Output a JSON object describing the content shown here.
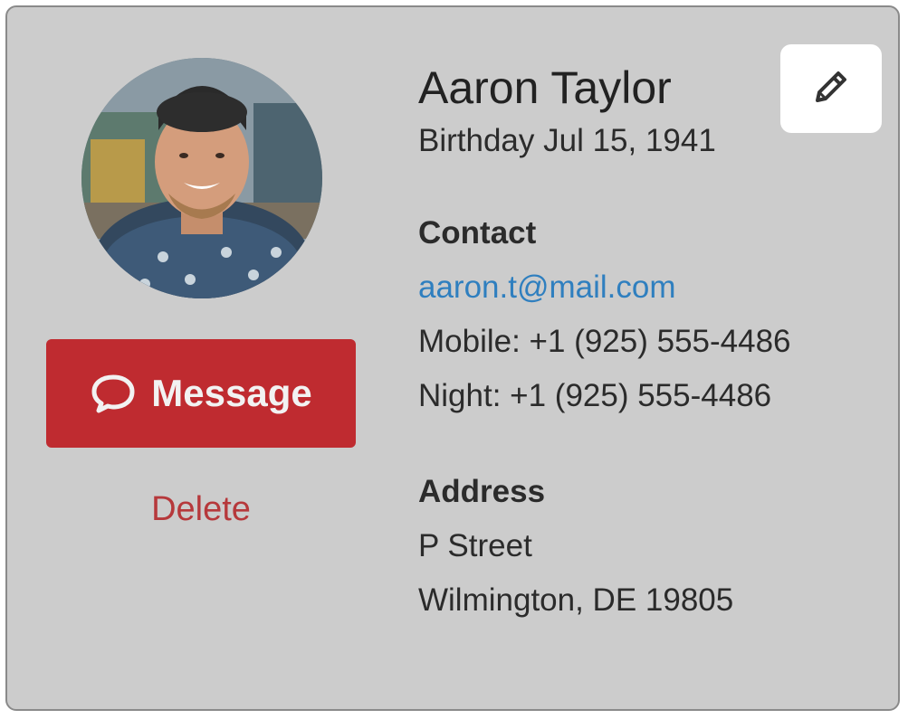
{
  "person": {
    "name": "Aaron Taylor",
    "birthday": "Birthday Jul 15, 1941"
  },
  "contact": {
    "heading": "Contact",
    "email": "aaron.t@mail.com",
    "mobile": "Mobile: +1 (925) 555-4486",
    "night": "Night: +1 (925) 555-4486"
  },
  "address": {
    "heading": "Address",
    "street": "P Street",
    "city_line": "Wilmington, DE 19805"
  },
  "actions": {
    "message_label": "Message",
    "delete_label": "Delete",
    "edit_icon": "pencil-icon",
    "message_icon": "speech-bubble-icon"
  },
  "colors": {
    "card_background": "#cccccc",
    "message_button": "#bf2b30",
    "delete_text": "#b6383b",
    "email_link": "#2f7fbf",
    "edit_button_background": "#ffffff"
  }
}
